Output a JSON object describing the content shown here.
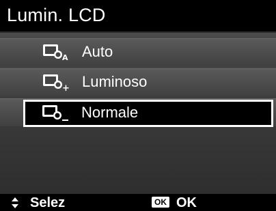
{
  "title": "Lumin. LCD",
  "menu": {
    "items": [
      {
        "label": "Auto",
        "icon": "lcd-brightness-auto-icon"
      },
      {
        "label": "Luminoso",
        "icon": "lcd-brightness-bright-icon"
      },
      {
        "label": "Normale",
        "icon": "lcd-brightness-normal-icon"
      }
    ],
    "selected_index": 2
  },
  "footer": {
    "select_label": "Selez",
    "ok_badge": "OK",
    "ok_label": "OK"
  }
}
